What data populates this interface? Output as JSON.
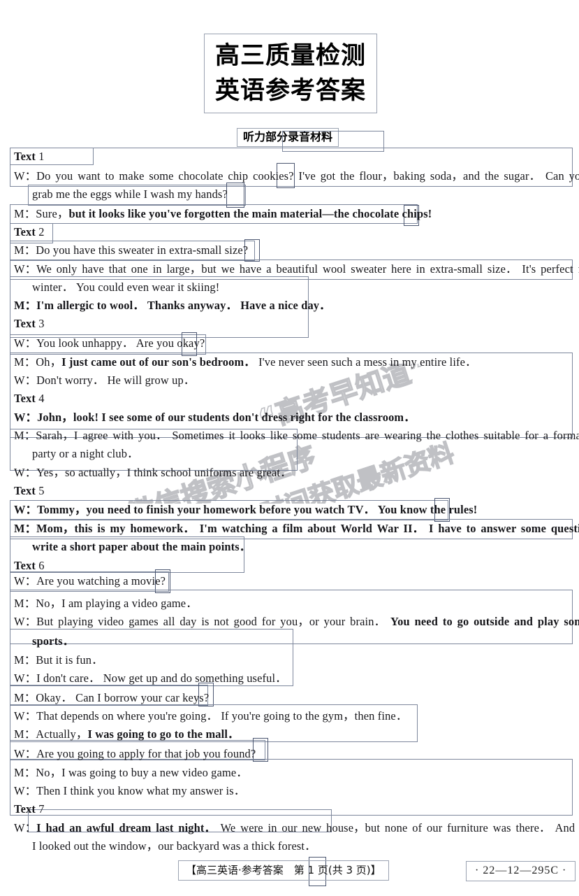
{
  "title": {
    "line1": "高三质量检测",
    "line2": "英语参考答案"
  },
  "section_header": "听力部分录音材料",
  "transcript": [
    {
      "kind": "heading",
      "label": "Text",
      "num": "1"
    },
    {
      "kind": "line",
      "speaker": "W",
      "text": "Do you want to make some chocolate chip cookies? I've got the flour，baking soda，and the sugar． Can you"
    },
    {
      "kind": "cont",
      "text": "grab me the eggs while I wash my hands?"
    },
    {
      "kind": "line",
      "speaker": "M",
      "plain": "Sure，",
      "bold": "but it looks like you've forgotten the main material—the chocolate chips!"
    },
    {
      "kind": "heading",
      "label": "Text",
      "num": "2"
    },
    {
      "kind": "line",
      "speaker": "M",
      "text": "Do you have this sweater in extra-small size?"
    },
    {
      "kind": "line",
      "speaker": "W",
      "text": "We only have that one in large，but we have a beautiful wool sweater here in extra-small size． It's perfect for"
    },
    {
      "kind": "cont",
      "text": "winter． You could even wear it skiing!"
    },
    {
      "kind": "line",
      "speaker": "M",
      "bold": "I'm allergic to wool． Thanks anyway． Have a nice day．"
    },
    {
      "kind": "heading",
      "label": "Text",
      "num": "3"
    },
    {
      "kind": "line",
      "speaker": "W",
      "text": "You look unhappy． Are you okay?"
    },
    {
      "kind": "line",
      "speaker": "M",
      "plain": "Oh，",
      "bold": "I just came out of our son's bedroom．",
      "plain2": " I've never seen such a mess in my entire life．"
    },
    {
      "kind": "line",
      "speaker": "W",
      "text": "Don't worry． He will grow up．"
    },
    {
      "kind": "heading",
      "label": "Text",
      "num": "4"
    },
    {
      "kind": "line",
      "speaker": "W",
      "bold": "John，look! I see some of our students don't dress right for the classroom．"
    },
    {
      "kind": "line",
      "speaker": "M",
      "text": "Sarah，I agree with you． Sometimes it looks like some students are wearing the clothes suitable for a formal"
    },
    {
      "kind": "cont",
      "text": "party or a night club．"
    },
    {
      "kind": "line",
      "speaker": "W",
      "text": "Yes，so actually，I think school uniforms are great．"
    },
    {
      "kind": "heading",
      "label": "Text",
      "num": "5"
    },
    {
      "kind": "line",
      "speaker": "W",
      "bold": "Tommy，you need to finish your homework before you watch TV． You know the rules!"
    },
    {
      "kind": "line",
      "speaker": "M",
      "bold": "Mom，this is my homework． I'm watching a film about World War II． I have to answer some questions and"
    },
    {
      "kind": "cont",
      "bold": "write a short paper about the main points．"
    },
    {
      "kind": "heading",
      "label": "Text",
      "num": "6"
    },
    {
      "kind": "line",
      "speaker": "W",
      "text": "Are you watching a movie?"
    },
    {
      "kind": "line",
      "speaker": "M",
      "text": "No，I am playing a video game．"
    },
    {
      "kind": "line",
      "speaker": "W",
      "plain": "But playing video games all day is not good for you，or your brain． ",
      "bold": "You need to go outside and play some"
    },
    {
      "kind": "cont",
      "bold": "sports．"
    },
    {
      "kind": "line",
      "speaker": "M",
      "text": "But it is fun．"
    },
    {
      "kind": "line",
      "speaker": "W",
      "text": "I don't care． Now get up and do something useful．"
    },
    {
      "kind": "line",
      "speaker": "M",
      "text": "Okay． Can I borrow your car keys?"
    },
    {
      "kind": "line",
      "speaker": "W",
      "text": "That depends on where you're going． If you're going to the gym，then fine．"
    },
    {
      "kind": "line",
      "speaker": "M",
      "plain": "Actually，",
      "bold": "I was going to go to the mall．"
    },
    {
      "kind": "line",
      "speaker": "W",
      "text": "Are you going to apply for that job you found?"
    },
    {
      "kind": "line",
      "speaker": "M",
      "text": "No，I was going to buy a new video game．"
    },
    {
      "kind": "line",
      "speaker": "W",
      "text": "Then I think you know what my answer is．"
    },
    {
      "kind": "heading",
      "label": "Text",
      "num": "7"
    },
    {
      "kind": "line",
      "speaker": "W",
      "bold": "I had an awful dream last night．",
      "plain2": " We were in our new house，but none of our furniture was there． And when"
    },
    {
      "kind": "cont",
      "text": "I looked out the window，our backyard was a thick forest．"
    }
  ],
  "watermark": {
    "line1": "微信搜索小程序",
    "line2": "“高考早知道”",
    "line3": "第一时间获取最新资料"
  },
  "footer": {
    "center": "【高三英语·参考答案　第 1 页(共 3 页)】",
    "code": "· 22—12—295C ·"
  },
  "colors": {
    "box_border": "#7d879c",
    "box_border_dark": "#4b5670",
    "text": "#16161a"
  }
}
